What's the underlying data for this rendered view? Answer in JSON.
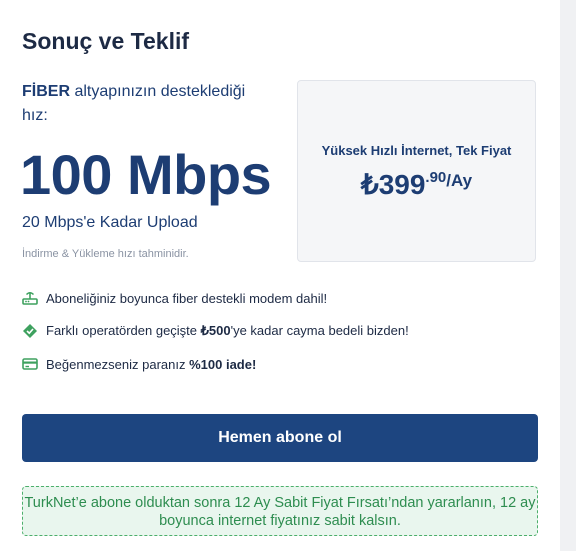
{
  "title": "Sonuç ve Teklif",
  "speed": {
    "tech": "FİBER",
    "intro_rest": " altyapınızın desteklediği hız:",
    "value": "100 Mbps",
    "upload": "20 Mbps'e Kadar Upload",
    "disclaimer": "İndirme & Yükleme hızı tahminidir."
  },
  "offer": {
    "label": "Yüksek Hızlı İnternet, Tek Fiyat",
    "currency": "₺",
    "price_main": "399",
    "price_decimal": ".90",
    "price_period": "/Ay"
  },
  "features": [
    {
      "icon": "modem-icon",
      "pre": "Aboneliğiniz boyunca fiber destekli modem dahil!",
      "bold": "",
      "post": ""
    },
    {
      "icon": "tag-icon",
      "pre": "Farklı operatörden geçişte ",
      "bold": "₺500",
      "post": "'ye kadar cayma bedeli bizden!"
    },
    {
      "icon": "card-icon",
      "pre": "Beğenmezseniz paranız ",
      "bold": "%100 iade!",
      "post": ""
    }
  ],
  "cta": {
    "label": "Hemen abone ol"
  },
  "promo": {
    "text": "TurkNet’e abone olduktan sonra 12 Ay Sabit Fiyat Fırsatı’ndan yararlanın, 12 ay boyunca internet fiyatınız sabit kalsın."
  },
  "colors": {
    "primary": "#1d4580",
    "text": "#1d3d73",
    "accent_green": "#3ea15f",
    "promo_bg": "#e9f6ee"
  }
}
